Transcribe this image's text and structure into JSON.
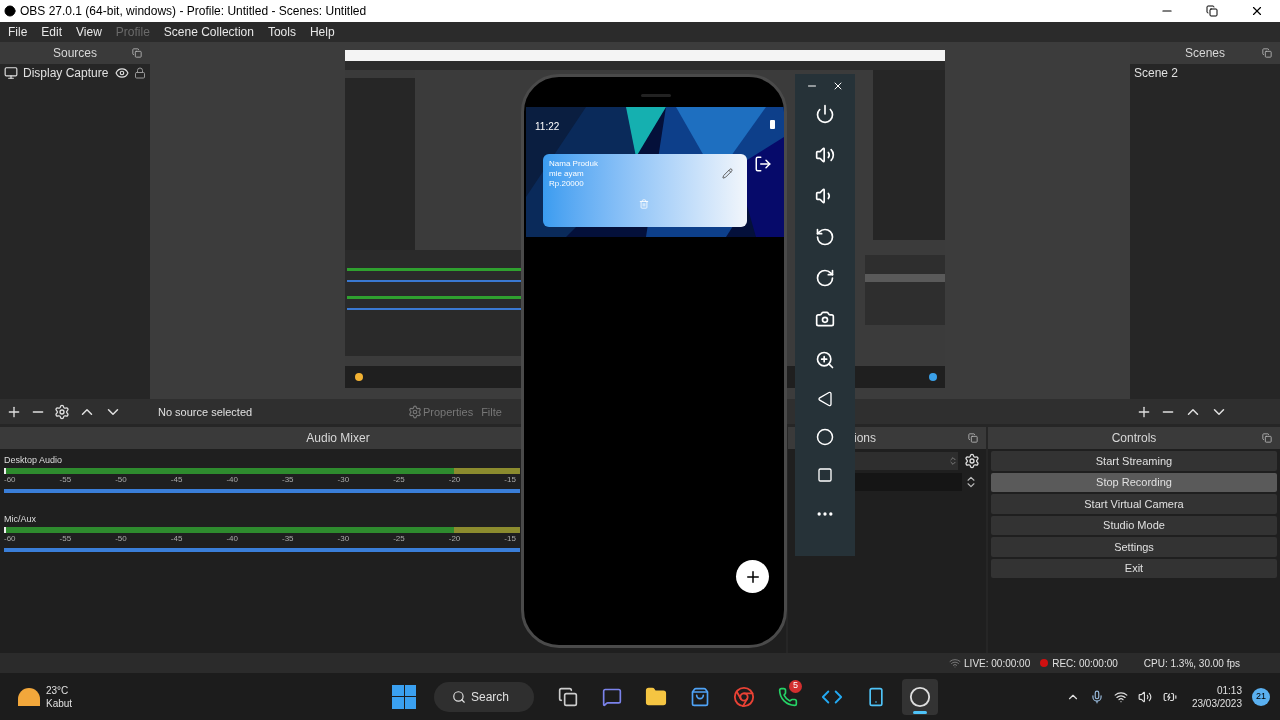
{
  "window": {
    "title": "OBS 27.0.1 (64-bit, windows) - Profile: Untitled - Scenes: Untitled"
  },
  "menu": [
    {
      "label": "File",
      "disabled": false
    },
    {
      "label": "Edit",
      "disabled": false
    },
    {
      "label": "View",
      "disabled": false
    },
    {
      "label": "Profile",
      "disabled": true
    },
    {
      "label": "Scene Collection",
      "disabled": false
    },
    {
      "label": "Tools",
      "disabled": false
    },
    {
      "label": "Help",
      "disabled": false
    }
  ],
  "sources": {
    "title": "Sources",
    "items": [
      {
        "label": "Display Capture",
        "selected": false
      }
    ]
  },
  "scenes": {
    "title": "Scenes",
    "items": [
      {
        "label": "Scene 2",
        "selected": false
      }
    ]
  },
  "source_toolbar": {
    "status": "No source selected",
    "properties": "Properties",
    "filters": "Filte"
  },
  "audio_mixer": {
    "title": "Audio Mixer",
    "channels": [
      {
        "name": "Desktop Audio",
        "level": 1,
        "ticks": [
          "-60",
          "-55",
          "-50",
          "-45",
          "-40",
          "-35",
          "-30",
          "-25",
          "-20",
          "-15"
        ]
      },
      {
        "name": "Mic/Aux",
        "level": 1,
        "ticks": [
          "-60",
          "-55",
          "-50",
          "-45",
          "-40",
          "-35",
          "-30",
          "-25",
          "-20",
          "-15"
        ]
      }
    ]
  },
  "transitions": {
    "title": "ions"
  },
  "controls": {
    "title": "Controls",
    "buttons": [
      {
        "label": "Start Streaming",
        "hovered": false
      },
      {
        "label": "Stop Recording",
        "hovered": true
      },
      {
        "label": "Start Virtual Camera",
        "hovered": false
      },
      {
        "label": "Studio Mode",
        "hovered": false
      },
      {
        "label": "Settings",
        "hovered": false
      },
      {
        "label": "Exit",
        "hovered": false
      }
    ]
  },
  "status_bar": {
    "live": "LIVE: 00:00:00",
    "rec": "REC: 00:00:00",
    "cpu": "CPU: 1.3%, 30.00 fps"
  },
  "phone": {
    "time": "11:22",
    "card": [
      "Nama Produk",
      "mie ayam",
      "Rp.20000"
    ]
  },
  "taskbar": {
    "temperature": "23°C",
    "weather": "Kabut",
    "search": "Search",
    "apps": [
      {
        "kind": "taskview",
        "active": false
      },
      {
        "kind": "chat",
        "active": false
      },
      {
        "kind": "folder",
        "active": false
      },
      {
        "kind": "store",
        "active": false
      },
      {
        "kind": "browser",
        "active": false
      },
      {
        "kind": "whatsapp",
        "active": false,
        "badge": "5"
      },
      {
        "kind": "code",
        "active": false
      },
      {
        "kind": "phone",
        "active": false
      },
      {
        "kind": "obs",
        "active": true
      }
    ],
    "time": "01:13",
    "date": "23/03/2023",
    "notifications": "21"
  }
}
